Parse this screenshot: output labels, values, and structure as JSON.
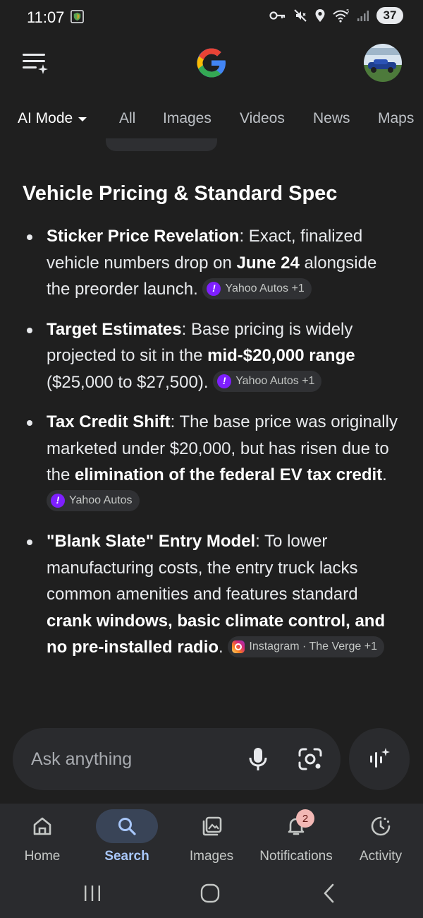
{
  "status_bar": {
    "time": "11:07",
    "battery": "37",
    "icons": [
      "shield-icon",
      "key-icon",
      "mute-icon",
      "location-icon",
      "wifi-icon",
      "signal-icon"
    ]
  },
  "header": {
    "menu_icon": "menu-sparkle-icon",
    "logo": "google-logo",
    "logo_colors": [
      "#4285f4",
      "#ea4335",
      "#fbbc05",
      "#34a853"
    ]
  },
  "tabs": [
    {
      "label": "AI Mode",
      "active": true
    },
    {
      "label": "All"
    },
    {
      "label": "Images"
    },
    {
      "label": "Videos"
    },
    {
      "label": "News"
    },
    {
      "label": "Maps"
    }
  ],
  "content": {
    "section_title": "Vehicle Pricing & Standard Spec",
    "bullets": [
      {
        "head": "Sticker Price Revelation",
        "text1": ": Exact, finalized vehicle numbers drop on ",
        "bold1": "June 24",
        "text2": " alongside the preorder launch.",
        "source": "Yahoo Autos +1"
      },
      {
        "head": "Target Estimates",
        "text1": ": Base pricing is widely projected to sit in the ",
        "bold1": "mid-$20,000 range",
        "text2": " ($25,000 to $27,500).",
        "source": "Yahoo Autos +1"
      },
      {
        "head": "Tax Credit Shift",
        "text1": ": The base price was originally marketed under $20,000, but has risen due to the ",
        "bold1": "elimination of the federal EV tax credit",
        "text2": ".",
        "source": "Yahoo Autos"
      },
      {
        "head": "\"Blank Slate\" Entry Model",
        "text1": ": To lower manufacturing costs, the entry truck lacks common amenities and features standard ",
        "bold1": "crank windows, basic climate control, and no pre-installed radio",
        "text2": ".",
        "source": "Instagram · The Verge +1"
      }
    ]
  },
  "ask_bar": {
    "placeholder": "Ask anything"
  },
  "bottom_nav": {
    "items": [
      {
        "label": "Home",
        "icon": "home-icon"
      },
      {
        "label": "Search",
        "icon": "search-icon",
        "active": true
      },
      {
        "label": "Images",
        "icon": "images-icon"
      },
      {
        "label": "Notifications",
        "icon": "bell-icon",
        "badge": "2"
      },
      {
        "label": "Activity",
        "icon": "activity-icon"
      }
    ]
  },
  "colors": {
    "background": "#1f1f1f",
    "nav_background": "#2a2b2e",
    "active_nav": "#a8c7fa",
    "active_pill": "#394457",
    "source_badge": "#7e1fff",
    "notification_badge": "#f2b8b5"
  }
}
